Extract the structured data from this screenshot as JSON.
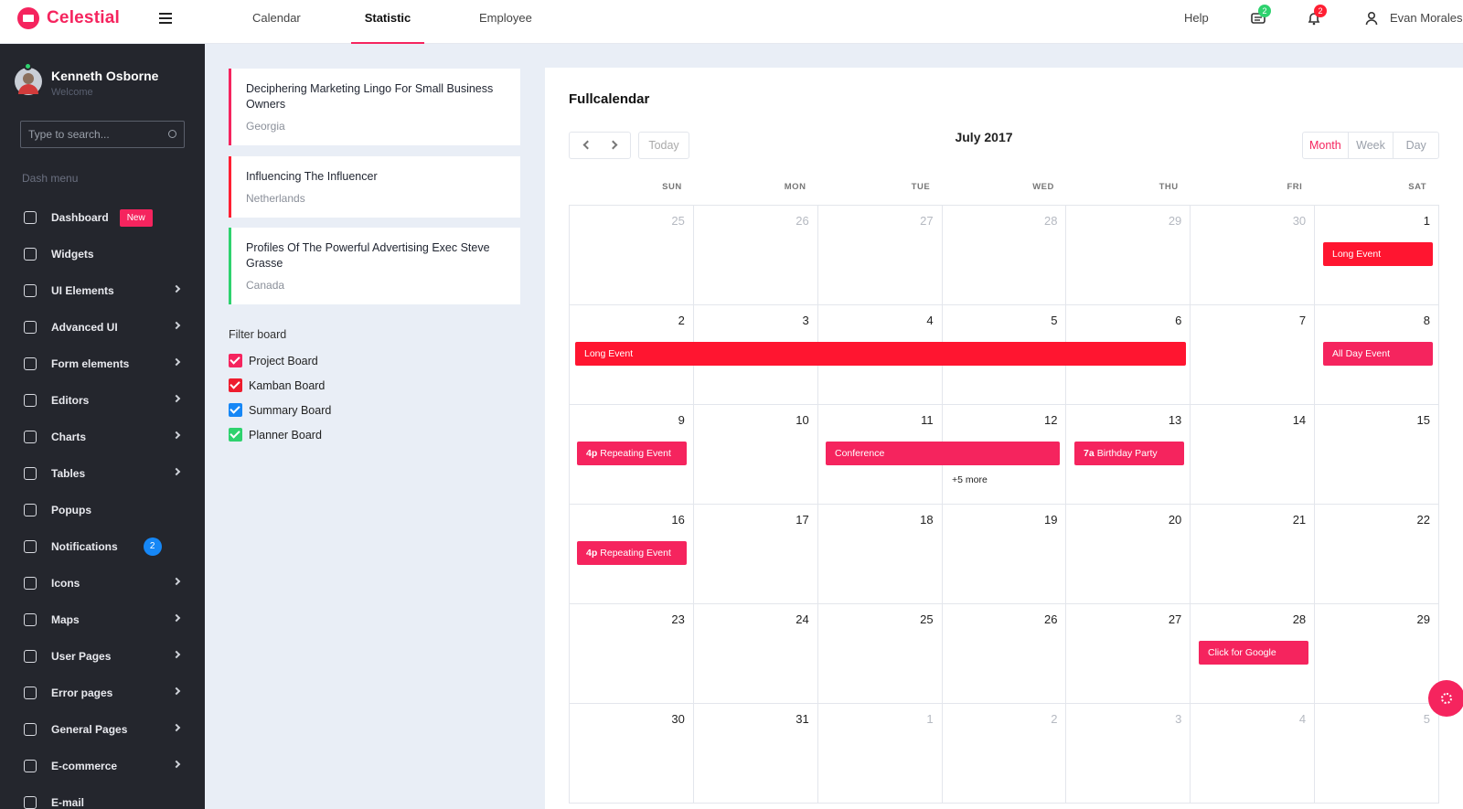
{
  "brand": {
    "name": "Celestial"
  },
  "topnav": {
    "items": [
      {
        "label": "Calendar"
      },
      {
        "label": "Statistic"
      },
      {
        "label": "Employee"
      }
    ]
  },
  "topright": {
    "help": "Help",
    "messages_count": "2",
    "notifications_count": "2",
    "user_name": "Evan Morales"
  },
  "sidebar": {
    "user": {
      "name": "Kenneth Osborne",
      "welcome": "Welcome"
    },
    "search_placeholder": "Type to search...",
    "section": "Dash menu",
    "items": [
      {
        "label": "Dashboard",
        "badge": "New",
        "icon": "monitor-icon"
      },
      {
        "label": "Widgets",
        "icon": "widget-icon"
      },
      {
        "label": "UI Elements",
        "icon": "ui-icon",
        "chevron": true
      },
      {
        "label": "Advanced UI",
        "icon": "settings-icon",
        "chevron": true
      },
      {
        "label": "Form elements",
        "icon": "form-icon",
        "chevron": true
      },
      {
        "label": "Editors",
        "icon": "editor-icon",
        "chevron": true
      },
      {
        "label": "Charts",
        "icon": "chart-icon",
        "chevron": true
      },
      {
        "label": "Tables",
        "icon": "table-icon",
        "chevron": true
      },
      {
        "label": "Popups",
        "icon": "popup-icon"
      },
      {
        "label": "Notifications",
        "icon": "bell-icon",
        "count": "2"
      },
      {
        "label": "Icons",
        "icon": "compass-icon",
        "chevron": true
      },
      {
        "label": "Maps",
        "icon": "map-icon",
        "chevron": true
      },
      {
        "label": "User Pages",
        "icon": "user-icon",
        "chevron": true
      },
      {
        "label": "Error pages",
        "icon": "error-icon",
        "chevron": true
      },
      {
        "label": "General Pages",
        "icon": "page-icon",
        "chevron": true
      },
      {
        "label": "E-commerce",
        "icon": "cart-icon",
        "chevron": true
      },
      {
        "label": "E-mail",
        "icon": "mail-icon"
      }
    ]
  },
  "cards": [
    {
      "title": "Deciphering Marketing Lingo For Small Business Owners",
      "subtitle": "Georgia",
      "color": "#f5245e"
    },
    {
      "title": "Influencing The Influencer",
      "subtitle": "Netherlands",
      "color": "#ff1f33"
    },
    {
      "title": "Profiles Of The Powerful Advertising Exec Steve Grasse",
      "subtitle": "Canada",
      "color": "#2ed26e"
    }
  ],
  "filter": {
    "title": "Filter board",
    "boards": [
      {
        "label": "Project Board",
        "color": "#f5245e",
        "checked": true
      },
      {
        "label": "Kamban Board",
        "color": "#ee1d2e",
        "checked": true
      },
      {
        "label": "Summary Board",
        "color": "#1687f6",
        "checked": true
      },
      {
        "label": "Planner Board",
        "color": "#2ed26e",
        "checked": true
      }
    ]
  },
  "calendar": {
    "title": "Fullcalendar",
    "today_label": "Today",
    "month_label": "July 2017",
    "views": [
      "Month",
      "Week",
      "Day"
    ],
    "dow": [
      "SUN",
      "MON",
      "TUE",
      "WED",
      "THU",
      "FRI",
      "SAT"
    ],
    "weeks": [
      [
        {
          "d": "25",
          "o": true
        },
        {
          "d": "26",
          "o": true
        },
        {
          "d": "27",
          "o": true
        },
        {
          "d": "28",
          "o": true
        },
        {
          "d": "29",
          "o": true
        },
        {
          "d": "30",
          "o": true
        },
        {
          "d": "1"
        }
      ],
      [
        {
          "d": "2"
        },
        {
          "d": "3"
        },
        {
          "d": "4"
        },
        {
          "d": "5"
        },
        {
          "d": "6"
        },
        {
          "d": "7"
        },
        {
          "d": "8"
        }
      ],
      [
        {
          "d": "9"
        },
        {
          "d": "10"
        },
        {
          "d": "11"
        },
        {
          "d": "12"
        },
        {
          "d": "13"
        },
        {
          "d": "14"
        },
        {
          "d": "15"
        }
      ],
      [
        {
          "d": "16"
        },
        {
          "d": "17"
        },
        {
          "d": "18"
        },
        {
          "d": "19"
        },
        {
          "d": "20"
        },
        {
          "d": "21"
        },
        {
          "d": "22"
        }
      ],
      [
        {
          "d": "23"
        },
        {
          "d": "24"
        },
        {
          "d": "25"
        },
        {
          "d": "26"
        },
        {
          "d": "27"
        },
        {
          "d": "28"
        },
        {
          "d": "29"
        }
      ],
      [
        {
          "d": "30"
        },
        {
          "d": "31"
        },
        {
          "d": "1",
          "o": true
        },
        {
          "d": "2",
          "o": true
        },
        {
          "d": "3",
          "o": true
        },
        {
          "d": "4",
          "o": true
        },
        {
          "d": "5",
          "o": true
        }
      ]
    ],
    "events": [
      {
        "week": 0,
        "start": 6,
        "span": 1,
        "label": "Long Event",
        "color": "#ff1530"
      },
      {
        "week": 1,
        "start": 0,
        "span": 5,
        "label": "Long Event",
        "color": "#ff1530"
      },
      {
        "week": 1,
        "start": 6,
        "span": 1,
        "label": "All Day Event",
        "color": "#f5245e"
      },
      {
        "week": 2,
        "start": 0,
        "span": 1,
        "time": "4p",
        "label": "Repeating Event",
        "color": "#f5245e"
      },
      {
        "week": 2,
        "start": 2,
        "span": 2,
        "label": "Conference",
        "color": "#f5245e"
      },
      {
        "week": 2,
        "start": 4,
        "span": 1,
        "time": "7a",
        "label": "Birthday Party",
        "color": "#f5245e"
      },
      {
        "week": 3,
        "start": 0,
        "span": 1,
        "time": "4p",
        "label": "Repeating Event",
        "color": "#f5245e"
      },
      {
        "week": 4,
        "start": 5,
        "span": 1,
        "label": "Click for Google",
        "color": "#f5245e"
      }
    ],
    "more": {
      "week": 2,
      "col": 3,
      "label": "+5 more"
    }
  }
}
